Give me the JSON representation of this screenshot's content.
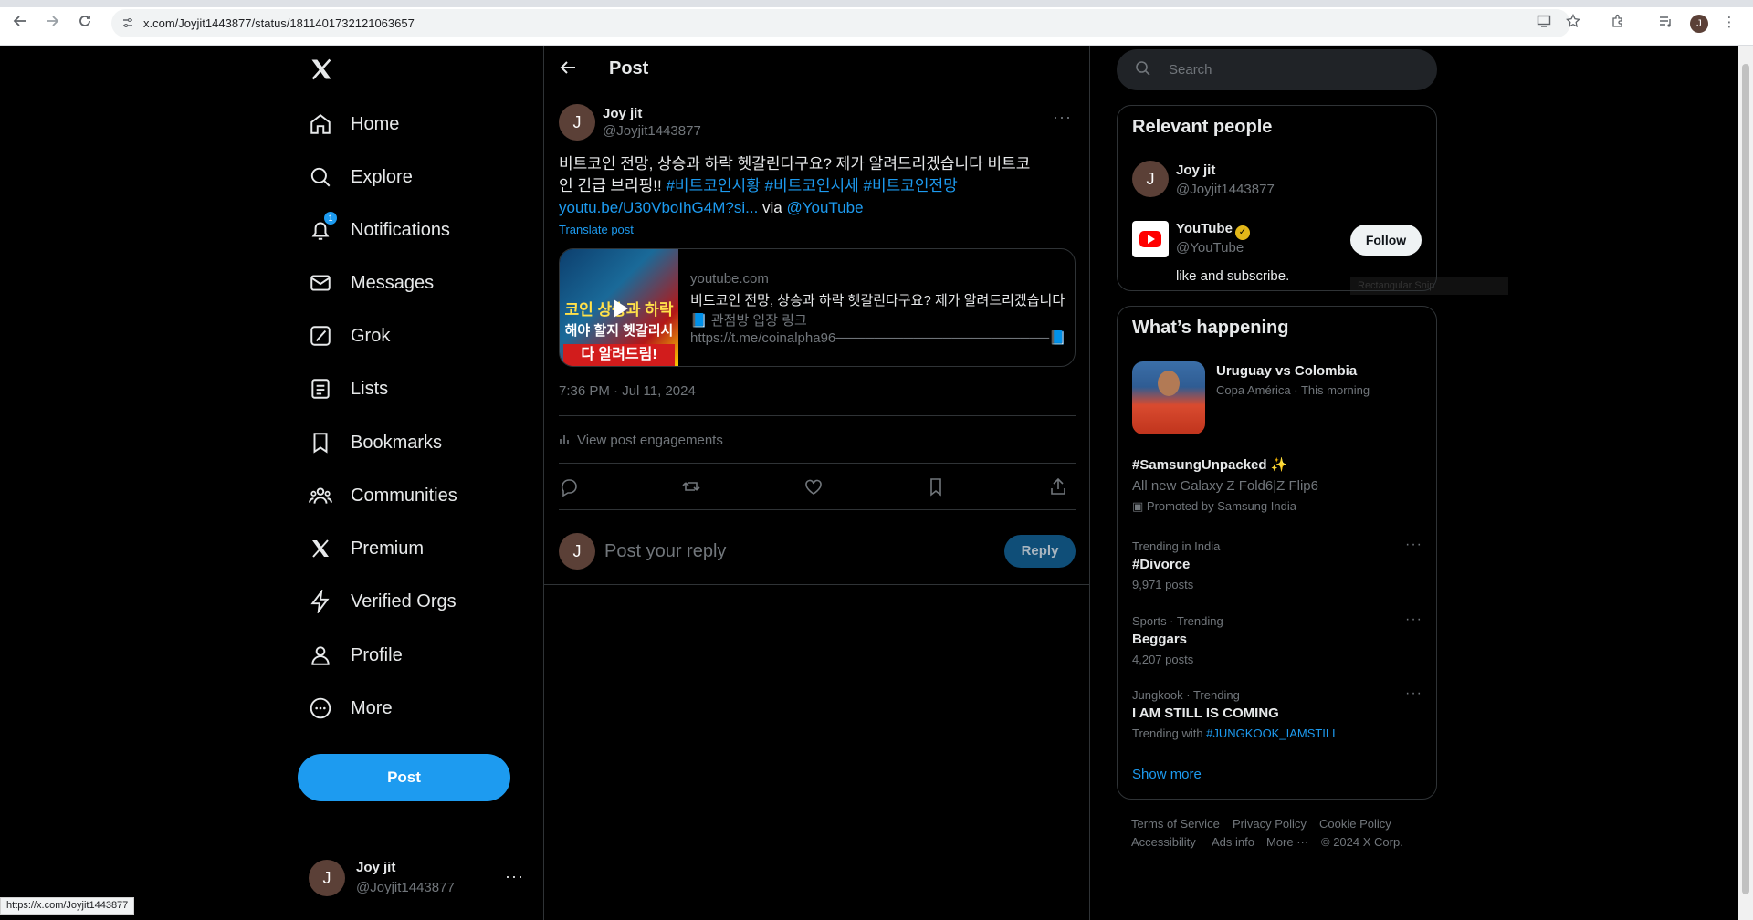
{
  "browser": {
    "url": "x.com/Joyjit1443877/status/1811401732121063657",
    "profile_initial": "J",
    "status_url": "https://x.com/Joyjit1443877"
  },
  "sidebar": {
    "logo": "X",
    "items": [
      {
        "label": "Home",
        "icon": "home-icon"
      },
      {
        "label": "Explore",
        "icon": "search-icon"
      },
      {
        "label": "Notifications",
        "icon": "bell-icon",
        "badge": "1"
      },
      {
        "label": "Messages",
        "icon": "mail-icon"
      },
      {
        "label": "Grok",
        "icon": "grok-icon"
      },
      {
        "label": "Lists",
        "icon": "list-icon"
      },
      {
        "label": "Bookmarks",
        "icon": "bookmark-icon"
      },
      {
        "label": "Communities",
        "icon": "communities-icon"
      },
      {
        "label": "Premium",
        "icon": "x-premium-icon"
      },
      {
        "label": "Verified Orgs",
        "icon": "lightning-icon"
      },
      {
        "label": "Profile",
        "icon": "person-icon"
      },
      {
        "label": "More",
        "icon": "more-circle-icon"
      }
    ],
    "post_button": "Post",
    "account": {
      "initial": "J",
      "name": "Joy jit",
      "handle": "@Joyjit1443877",
      "more": "···"
    }
  },
  "main": {
    "header_title": "Post",
    "tweet": {
      "initial": "J",
      "name": "Joy jit",
      "handle": "@Joyjit1443877",
      "text_line1": "비트코인 전망, 상승과 하락 헷갈린다구요? 제가 알려드리겠습니다 비트코",
      "text_line2_plain": "인 긴급 브리핑!! ",
      "hashtags": "#비트코인시황 #비트코인시세 #비트코인전망",
      "link": "youtu.be/U30VboIhG4M?si...",
      "via": " via ",
      "mention": "@YouTube",
      "translate": "Translate post",
      "card": {
        "thumb_line1": "코인 상승과 하락",
        "thumb_line2": "해야 할지 헷갈리시",
        "thumb_line3": "다 알려드림!",
        "domain": "youtube.com",
        "title": "비트코인 전망, 상승과 하락 헷갈린다구요? 제가 알려드리겠습니다",
        "desc1": "📘 관점방 입장 링크",
        "desc2": "https://t.me/coinalpha96──────────────────────📘 ..."
      },
      "timestamp": "7:36 PM · Jul 11, 2024",
      "engagements": "View post engagements"
    },
    "reply": {
      "initial": "J",
      "placeholder": "Post your reply",
      "button": "Reply"
    }
  },
  "right": {
    "search_placeholder": "Search",
    "relevant": {
      "title": "Relevant people",
      "people": [
        {
          "initial": "J",
          "name": "Joy jit",
          "handle": "@Joyjit1443877"
        },
        {
          "name": "YouTube",
          "handle": "@YouTube",
          "bio": "like and subscribe.",
          "follow": "Follow"
        }
      ]
    },
    "happening": {
      "title": "What’s happening",
      "featured": {
        "title": "Uruguay vs Colombia",
        "meta": "Copa América · This morning"
      },
      "promoted": {
        "title": "#SamsungUnpacked",
        "subtitle": "All new Galaxy Z Fold6|Z Flip6",
        "meta": "Promoted by Samsung India"
      },
      "trends": [
        {
          "context": "Trending in India",
          "title": "#Divorce",
          "posts": "9,971 posts"
        },
        {
          "context": "Sports · Trending",
          "title": "Beggars",
          "posts": "4,207 posts"
        },
        {
          "context": "Jungkook · Trending",
          "title": "I AM STILL IS COMING",
          "posts_prefix": "Trending with ",
          "posts_link": "#JUNGKOOK_IAMSTILL"
        }
      ],
      "show_more": "Show more"
    },
    "footer": {
      "links": [
        "Terms of Service",
        "Privacy Policy",
        "Cookie Policy",
        "Accessibility",
        "Ads info",
        "More ···",
        "© 2024 X Corp."
      ]
    }
  },
  "overlay": {
    "ghost_tooltip": "Rectangular Snip"
  }
}
